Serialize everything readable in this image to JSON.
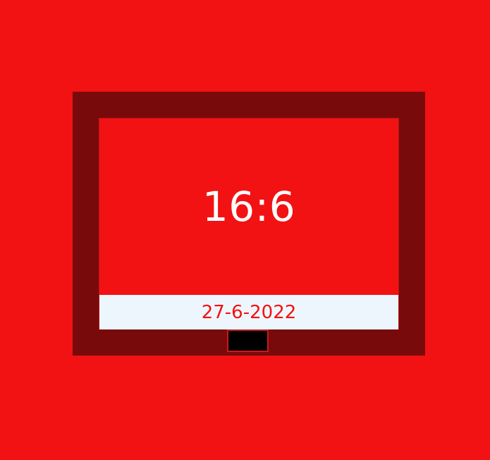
{
  "clock": {
    "time": "16:6",
    "date": "27-6-2022"
  },
  "colors": {
    "background": "#f21213",
    "frame": "#790a0b",
    "screen": "#f21213",
    "date_bar": "#eef6fd",
    "time_text": "#ffffff",
    "date_text": "#f21213",
    "stand": "#000000"
  },
  "icons": {
    "stand": "display-stand-icon"
  }
}
